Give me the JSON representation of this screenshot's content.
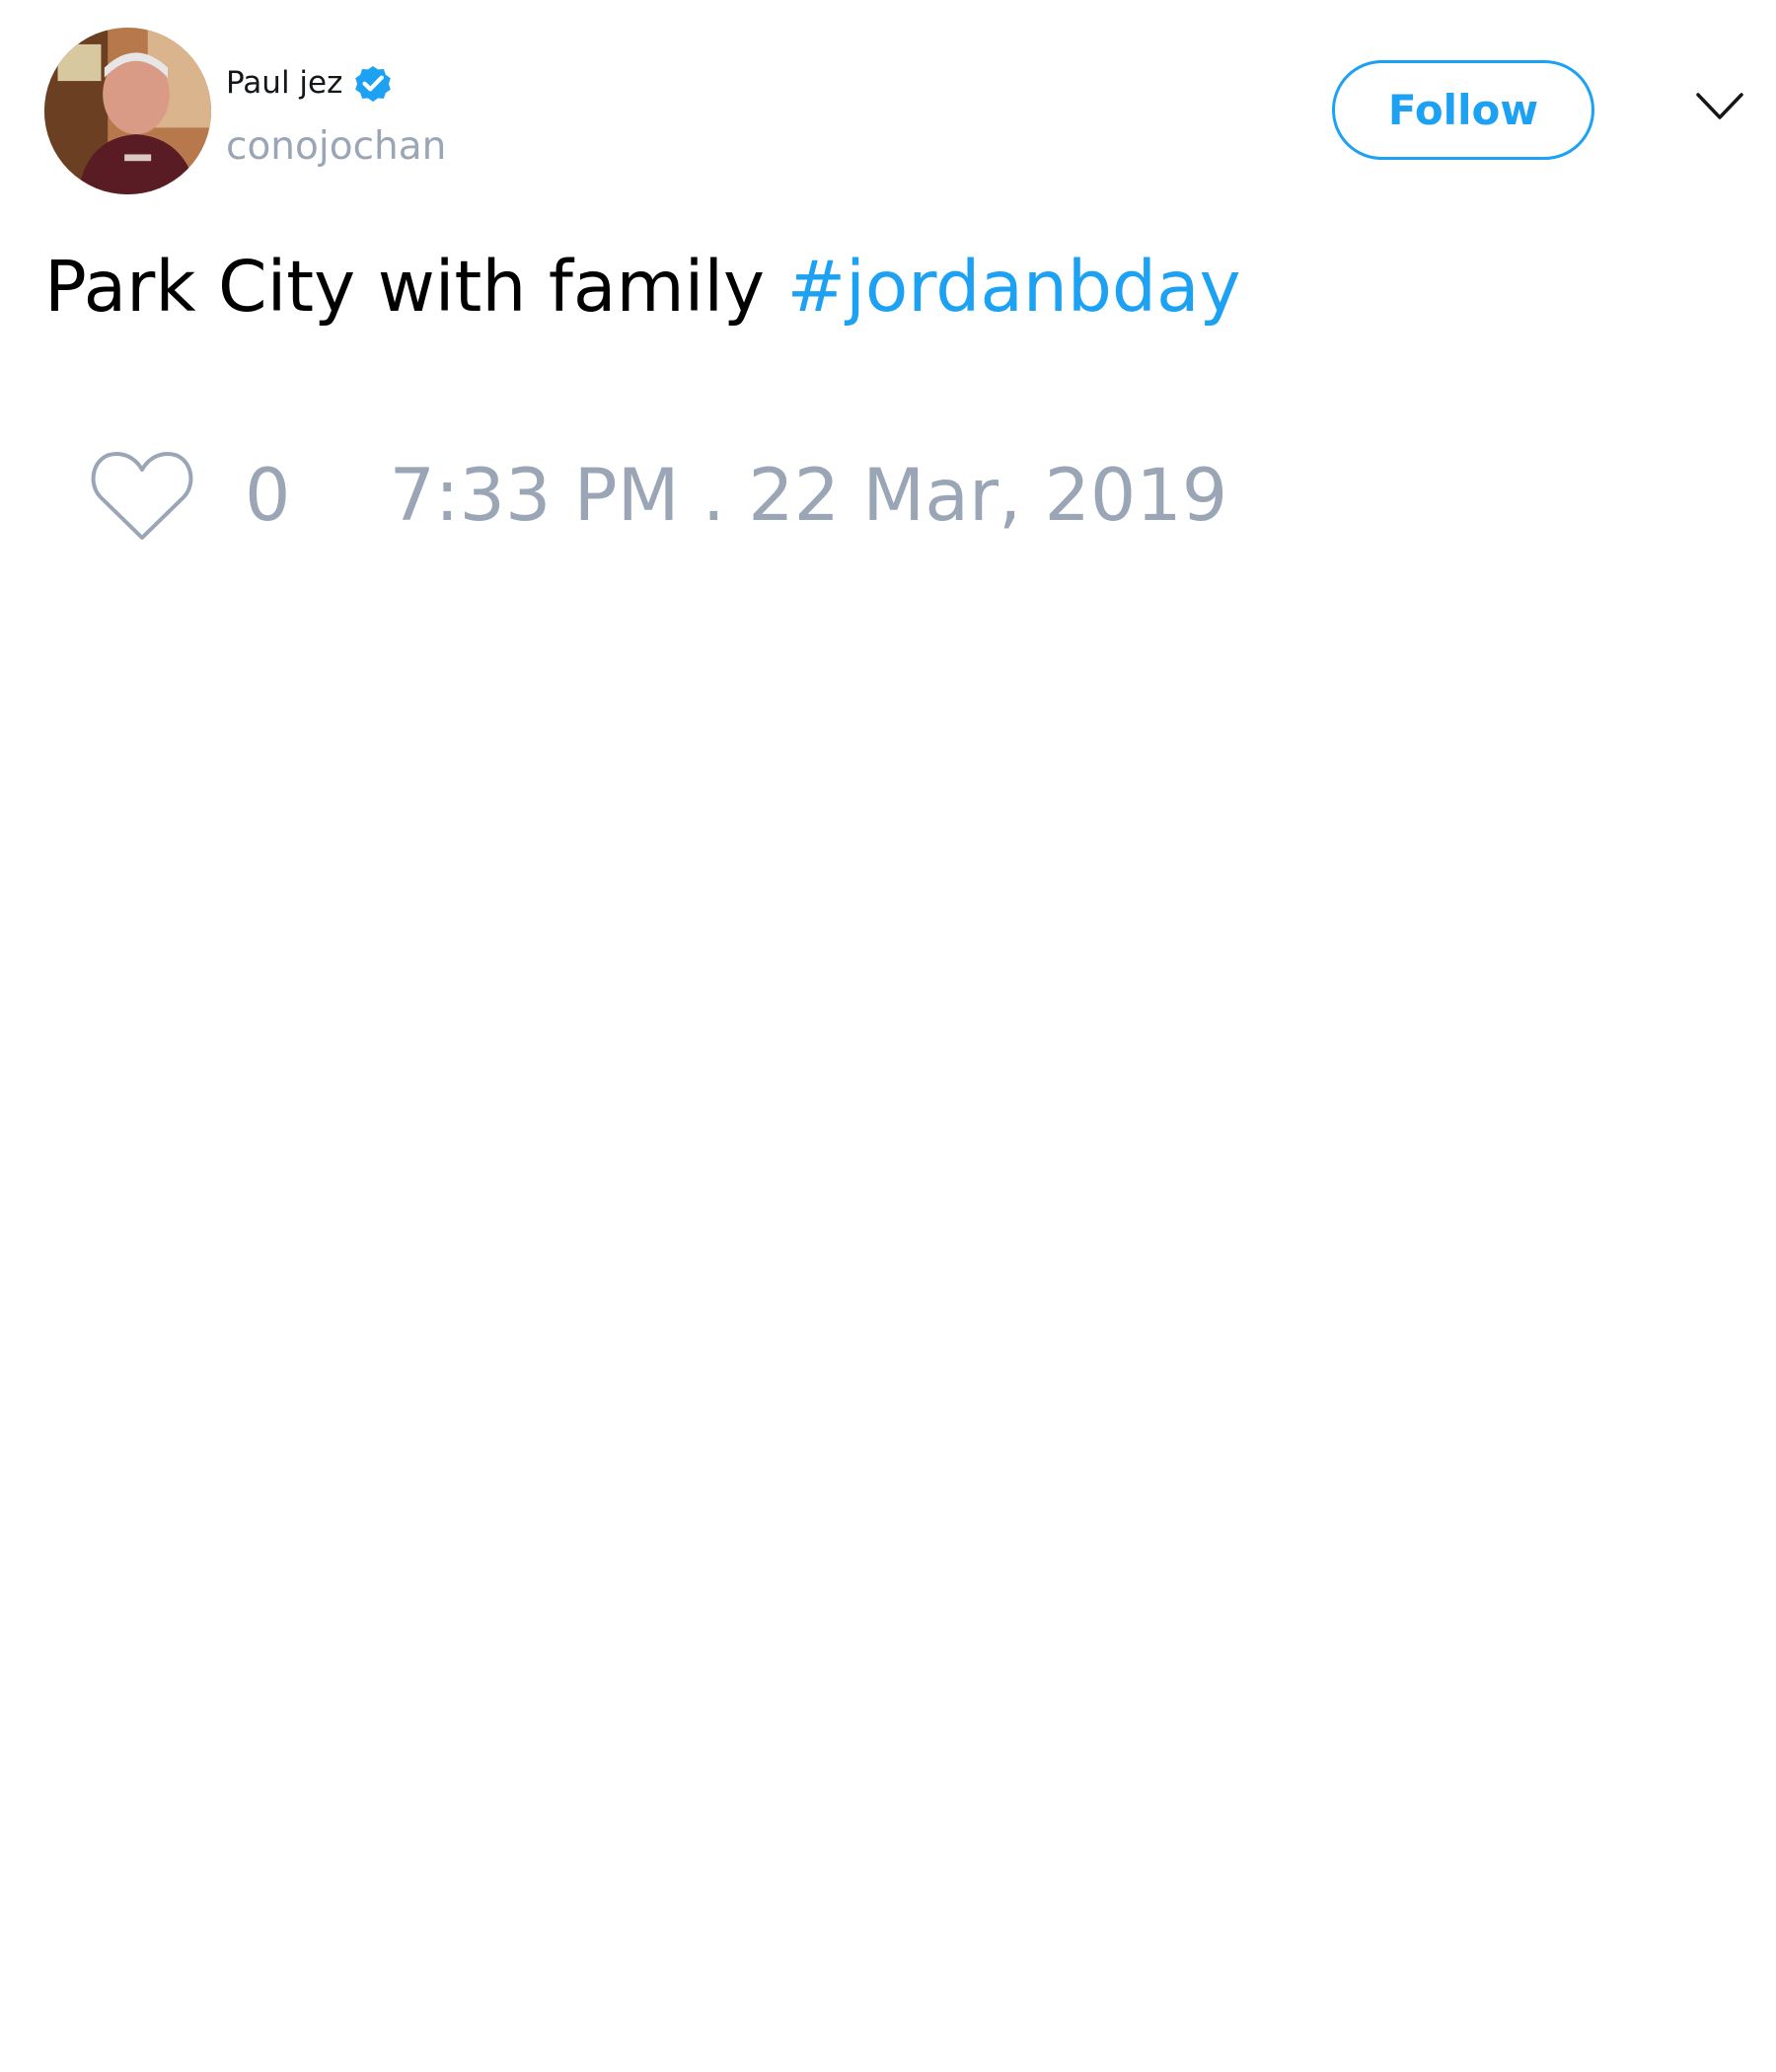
{
  "author": {
    "display_name": "Paul jez",
    "handle": "conojochan",
    "verified": true,
    "avatar_icon": "person-photo-icon",
    "verified_icon": "verified-badge-icon"
  },
  "actions": {
    "follow_label": "Follow",
    "menu_icon": "chevron-down-icon"
  },
  "tweet": {
    "text": "Park City with family",
    "hashtag": "#jordanbday"
  },
  "footer": {
    "like_icon": "heart-icon",
    "like_count": "0",
    "timestamp": "7:33 PM . 22 Mar, 2019"
  },
  "colors": {
    "accent": "#1da1f2",
    "muted": "#9aa6b6",
    "text": "#000000"
  }
}
